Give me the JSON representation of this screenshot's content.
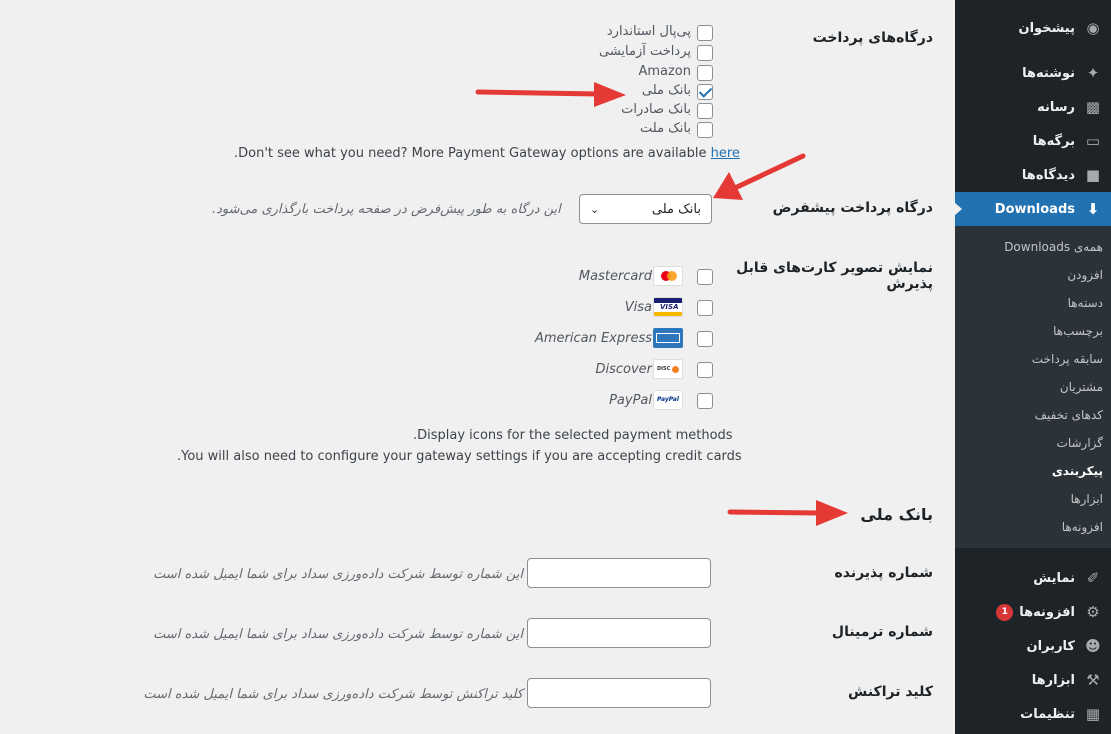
{
  "sidebar": {
    "items": [
      {
        "label": "پیشخوان",
        "icon": "dashboard-icon"
      },
      {
        "label": "نوشته‌ها",
        "icon": "pin-icon"
      },
      {
        "label": "رسانه",
        "icon": "media-icon"
      },
      {
        "label": "برگه‌ها",
        "icon": "page-icon"
      },
      {
        "label": "دیدگاه‌ها",
        "icon": "comment-icon"
      },
      {
        "label": "Downloads",
        "icon": "download-icon"
      }
    ],
    "submenu": [
      "همه‌ی Downloads",
      "افزودن",
      "دسته‌ها",
      "برچسب‌ها",
      "سابقه پرداخت",
      "مشتریان",
      "کدهای تخفیف",
      "گزارشات",
      "پیکربندی",
      "ابزارها",
      "افزونه‌ها"
    ],
    "lower": [
      {
        "label": "نمایش",
        "icon": "brush-icon"
      },
      {
        "label": "افزونه‌ها",
        "icon": "plugin-icon",
        "badge": "1"
      },
      {
        "label": "کاربران",
        "icon": "users-icon"
      },
      {
        "label": "ابزارها",
        "icon": "wrench-icon"
      },
      {
        "label": "تنظیمات",
        "icon": "settings-icon"
      }
    ]
  },
  "gateways": {
    "label": "درگاه‌های پرداخت",
    "options": [
      {
        "label": "پی‌پال استاندارد",
        "checked": false
      },
      {
        "label": "پرداخت آزمایشی",
        "checked": false
      },
      {
        "label": "Amazon",
        "checked": false
      },
      {
        "label": "بانک ملی",
        "checked": true
      },
      {
        "label": "بانک صادرات",
        "checked": false
      },
      {
        "label": "بانک ملت",
        "checked": false
      }
    ],
    "more_text": "Don't see what you need? More Payment Gateway options are available ",
    "more_link": "here",
    "more_end": "."
  },
  "default_gateway": {
    "label": "درگاه پرداخت پیشفرض",
    "selected": "بانک ملی",
    "help": "این درگاه به طور پیش‌فرض در صفحه پرداخت بارگذاری می‌شود."
  },
  "accepted_cards": {
    "label_line1": "نمایش تصویر کارت‌های قابل",
    "label_line2": "پذیرش",
    "cards": [
      {
        "name": "Mastercard",
        "icon": "mastercard-icon"
      },
      {
        "name": "Visa",
        "icon": "visa-icon"
      },
      {
        "name": "American Express",
        "icon": "amex-icon"
      },
      {
        "name": "Discover",
        "icon": "discover-icon"
      },
      {
        "name": "PayPal",
        "icon": "paypal-icon"
      }
    ],
    "desc1": ".Display icons for the selected payment methods",
    "desc2": ".You will also need to configure your gateway settings if you are accepting credit cards"
  },
  "bank_section": {
    "title": "بانک ملی",
    "fields": [
      {
        "label": "شماره پذیرنده",
        "value": "",
        "help": "این شماره توسط شرکت داده‌ورزی سداد برای شما ایمیل شده است"
      },
      {
        "label": "شماره ترمینال",
        "value": "",
        "help": "این شماره توسط شرکت داده‌ورزی سداد برای شما ایمیل شده است"
      },
      {
        "label": "کلید تراکنش",
        "value": "",
        "help": "کلید تراکنش توسط شرکت داده‌ورزی سداد برای شما ایمیل شده است"
      }
    ]
  },
  "colors": {
    "accent": "#2271b1",
    "arrow": "#e53935",
    "sidebar": "#1d2327"
  }
}
